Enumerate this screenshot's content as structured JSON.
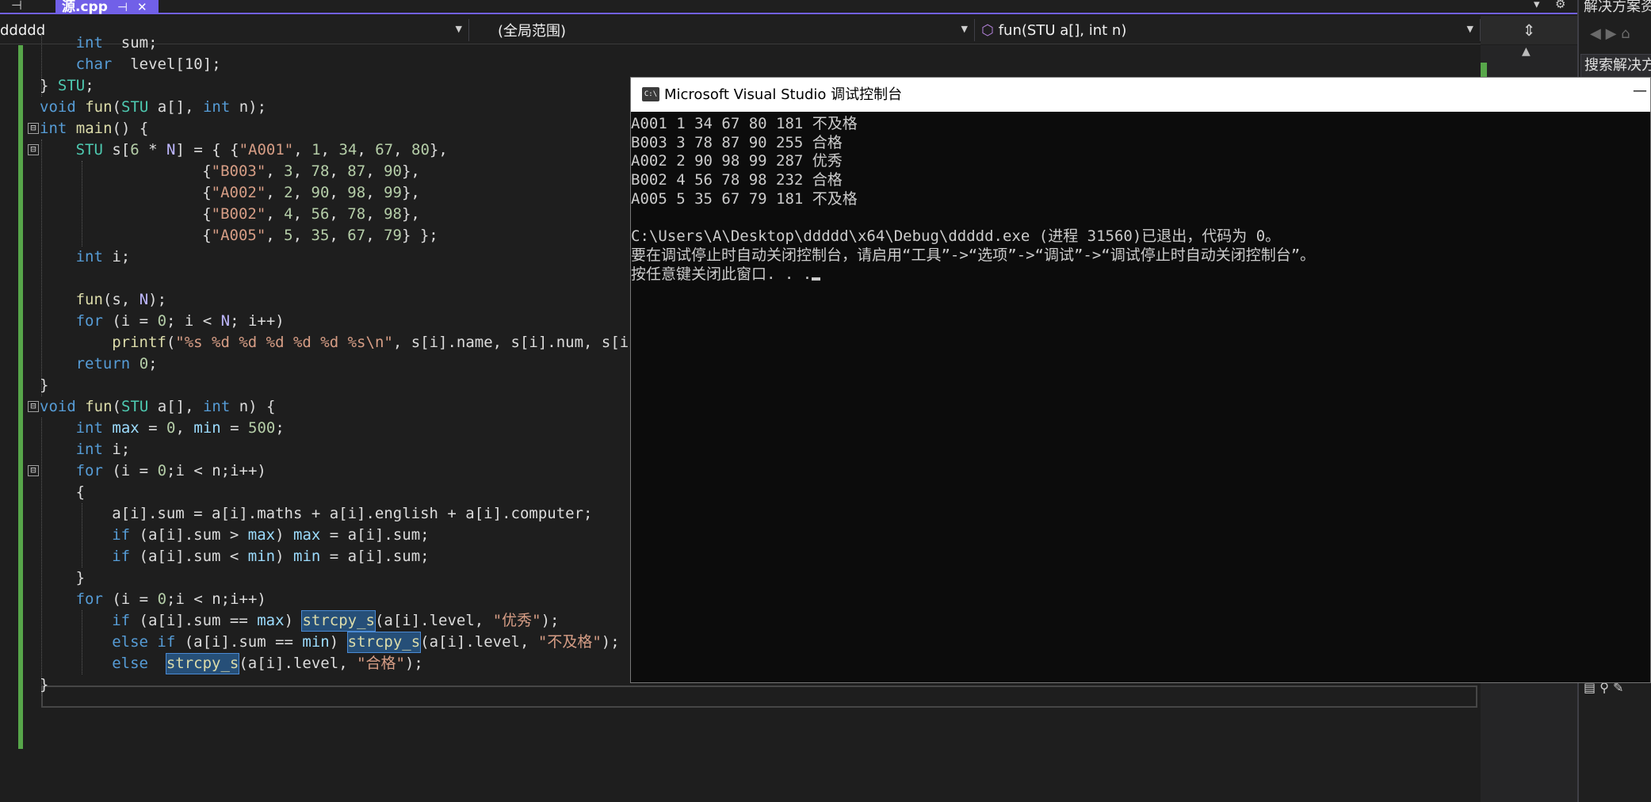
{
  "tabbar": {
    "pin_left": "⊣",
    "active_tab": {
      "title": "源.cpp",
      "pin": "⊣",
      "close": "✕"
    },
    "dropdown_icon": "▾",
    "settings_icon": "⚙"
  },
  "navbar": {
    "project": "ddddd",
    "scope": "(全局范围)",
    "member": "fun(STU a[], int n)",
    "split_icon": "⇕"
  },
  "editor": {
    "lines": [
      {
        "indent": 4,
        "tokens": [
          [
            "kw",
            "int"
          ],
          [
            "",
            "  sum;"
          ]
        ]
      },
      {
        "indent": 4,
        "tokens": [
          [
            "kw",
            "char"
          ],
          [
            "",
            "  level[10];"
          ]
        ]
      },
      {
        "indent": 0,
        "tokens": [
          [
            "",
            "} "
          ],
          [
            "ty",
            "STU"
          ],
          [
            "",
            ";"
          ]
        ]
      },
      {
        "indent": 0,
        "tokens": [
          [
            "kw",
            "void"
          ],
          [
            "",
            " "
          ],
          [
            "fn",
            "fun"
          ],
          [
            "",
            "("
          ],
          [
            "ty",
            "STU"
          ],
          [
            "",
            " a[], "
          ],
          [
            "kw",
            "int"
          ],
          [
            "",
            " n);"
          ]
        ]
      },
      {
        "indent": 0,
        "tokens": [
          [
            "kw",
            "int"
          ],
          [
            "",
            " "
          ],
          [
            "fn",
            "main"
          ],
          [
            "",
            "() {"
          ]
        ]
      },
      {
        "indent": 4,
        "tokens": [
          [
            "ty",
            "STU"
          ],
          [
            "",
            " s["
          ],
          [
            "nm",
            "6"
          ],
          [
            "",
            " * "
          ],
          [
            "mc",
            "N"
          ],
          [
            "",
            "] = { {"
          ],
          [
            "st",
            "\"A001\""
          ],
          [
            "",
            ", "
          ],
          [
            "nm",
            "1"
          ],
          [
            "",
            ", "
          ],
          [
            "nm",
            "34"
          ],
          [
            "",
            ", "
          ],
          [
            "nm",
            "67"
          ],
          [
            "",
            ", "
          ],
          [
            "nm",
            "80"
          ],
          [
            "",
            "},"
          ]
        ]
      },
      {
        "indent": 18,
        "tokens": [
          [
            "",
            "{"
          ],
          [
            "st",
            "\"B003\""
          ],
          [
            "",
            ", "
          ],
          [
            "nm",
            "3"
          ],
          [
            "",
            ", "
          ],
          [
            "nm",
            "78"
          ],
          [
            "",
            ", "
          ],
          [
            "nm",
            "87"
          ],
          [
            "",
            ", "
          ],
          [
            "nm",
            "90"
          ],
          [
            "",
            "},"
          ]
        ]
      },
      {
        "indent": 18,
        "tokens": [
          [
            "",
            "{"
          ],
          [
            "st",
            "\"A002\""
          ],
          [
            "",
            ", "
          ],
          [
            "nm",
            "2"
          ],
          [
            "",
            ", "
          ],
          [
            "nm",
            "90"
          ],
          [
            "",
            ", "
          ],
          [
            "nm",
            "98"
          ],
          [
            "",
            ", "
          ],
          [
            "nm",
            "99"
          ],
          [
            "",
            "},"
          ]
        ]
      },
      {
        "indent": 18,
        "tokens": [
          [
            "",
            "{"
          ],
          [
            "st",
            "\"B002\""
          ],
          [
            "",
            ", "
          ],
          [
            "nm",
            "4"
          ],
          [
            "",
            ", "
          ],
          [
            "nm",
            "56"
          ],
          [
            "",
            ", "
          ],
          [
            "nm",
            "78"
          ],
          [
            "",
            ", "
          ],
          [
            "nm",
            "98"
          ],
          [
            "",
            "},"
          ]
        ]
      },
      {
        "indent": 18,
        "tokens": [
          [
            "",
            "{"
          ],
          [
            "st",
            "\"A005\""
          ],
          [
            "",
            ", "
          ],
          [
            "nm",
            "5"
          ],
          [
            "",
            ", "
          ],
          [
            "nm",
            "35"
          ],
          [
            "",
            ", "
          ],
          [
            "nm",
            "67"
          ],
          [
            "",
            ", "
          ],
          [
            "nm",
            "79"
          ],
          [
            "",
            "} };"
          ]
        ]
      },
      {
        "indent": 4,
        "tokens": [
          [
            "kw",
            "int"
          ],
          [
            "",
            " i;"
          ]
        ]
      },
      {
        "indent": 0,
        "tokens": []
      },
      {
        "indent": 4,
        "tokens": [
          [
            "fn",
            "fun"
          ],
          [
            "",
            "(s, "
          ],
          [
            "mc",
            "N"
          ],
          [
            "",
            ");"
          ]
        ]
      },
      {
        "indent": 4,
        "tokens": [
          [
            "kw",
            "for"
          ],
          [
            "",
            " (i = "
          ],
          [
            "nm",
            "0"
          ],
          [
            "",
            "; i < "
          ],
          [
            "mc",
            "N"
          ],
          [
            "",
            "; i++)"
          ]
        ]
      },
      {
        "indent": 8,
        "tokens": [
          [
            "fn",
            "printf"
          ],
          [
            "",
            "("
          ],
          [
            "st",
            "\"%s %d %d %d %d %d %s\\n\""
          ],
          [
            "",
            ", s[i].name, s[i].num, s[i]"
          ]
        ]
      },
      {
        "indent": 4,
        "tokens": [
          [
            "kw",
            "return"
          ],
          [
            "",
            " "
          ],
          [
            "nm",
            "0"
          ],
          [
            "",
            ";"
          ]
        ]
      },
      {
        "indent": 0,
        "tokens": [
          [
            "",
            "}"
          ]
        ]
      },
      {
        "indent": 0,
        "tokens": [
          [
            "kw",
            "void"
          ],
          [
            "",
            " "
          ],
          [
            "fn",
            "fun"
          ],
          [
            "",
            "("
          ],
          [
            "ty",
            "STU"
          ],
          [
            "",
            " a[], "
          ],
          [
            "kw",
            "int"
          ],
          [
            "",
            " n) {"
          ]
        ]
      },
      {
        "indent": 4,
        "tokens": [
          [
            "kw",
            "int"
          ],
          [
            "",
            " "
          ],
          [
            "vr",
            "max"
          ],
          [
            "",
            " = "
          ],
          [
            "nm",
            "0"
          ],
          [
            "",
            ", "
          ],
          [
            "vr",
            "min"
          ],
          [
            "",
            " = "
          ],
          [
            "nm",
            "500"
          ],
          [
            "",
            ";"
          ]
        ]
      },
      {
        "indent": 4,
        "tokens": [
          [
            "kw",
            "int"
          ],
          [
            "",
            " i;"
          ]
        ]
      },
      {
        "indent": 4,
        "tokens": [
          [
            "kw",
            "for"
          ],
          [
            "",
            " (i = "
          ],
          [
            "nm",
            "0"
          ],
          [
            "",
            ";i < n;i++)"
          ]
        ]
      },
      {
        "indent": 4,
        "tokens": [
          [
            "",
            "{"
          ]
        ]
      },
      {
        "indent": 8,
        "tokens": [
          [
            "",
            "a[i].sum = a[i].maths + a[i].english + a[i].computer;"
          ]
        ]
      },
      {
        "indent": 8,
        "tokens": [
          [
            "kw",
            "if"
          ],
          [
            "",
            " (a[i].sum > "
          ],
          [
            "vr",
            "max"
          ],
          [
            "",
            ") "
          ],
          [
            "vr",
            "max"
          ],
          [
            "",
            " = a[i].sum;"
          ]
        ]
      },
      {
        "indent": 8,
        "tokens": [
          [
            "kw",
            "if"
          ],
          [
            "",
            " (a[i].sum < "
          ],
          [
            "vr",
            "min"
          ],
          [
            "",
            ") "
          ],
          [
            "vr",
            "min"
          ],
          [
            "",
            " = a[i].sum;"
          ]
        ]
      },
      {
        "indent": 4,
        "tokens": [
          [
            "",
            "}"
          ]
        ]
      },
      {
        "indent": 4,
        "tokens": [
          [
            "kw",
            "for"
          ],
          [
            "",
            " (i = "
          ],
          [
            "nm",
            "0"
          ],
          [
            "",
            ";i < n;i++)"
          ]
        ]
      },
      {
        "indent": 8,
        "tokens": [
          [
            "kw",
            "if"
          ],
          [
            "",
            " (a[i].sum == "
          ],
          [
            "vr",
            "max"
          ],
          [
            "",
            ") "
          ],
          [
            "fn",
            "strcpy_s"
          ],
          [
            "",
            "(a[i].level, "
          ],
          [
            "st",
            "\"优秀\""
          ],
          [
            "",
            ");"
          ]
        ]
      },
      {
        "indent": 8,
        "tokens": [
          [
            "kw",
            "else if"
          ],
          [
            "",
            " (a[i].sum == "
          ],
          [
            "vr",
            "min"
          ],
          [
            "",
            ") "
          ],
          [
            "fn",
            "strcpy_s"
          ],
          [
            "",
            "(a[i].level, "
          ],
          [
            "st",
            "\"不及格\""
          ],
          [
            "",
            ");"
          ]
        ]
      },
      {
        "indent": 8,
        "tokens": [
          [
            "kw",
            "else"
          ],
          [
            "",
            "  "
          ],
          [
            "fn",
            "strcpy_s"
          ],
          [
            "",
            "(a[i].level, "
          ],
          [
            "st",
            "\"合格\""
          ],
          [
            "",
            ");"
          ]
        ]
      },
      {
        "indent": 0,
        "tokens": [
          [
            "",
            "}"
          ]
        ]
      }
    ],
    "fold_markers": [
      "⊟",
      "⊟",
      "⊟",
      "⊟"
    ]
  },
  "console": {
    "title": "Microsoft Visual Studio 调试控制台",
    "icon_label": "C:\\",
    "minimize": "—",
    "lines": [
      "A001 1 34 67 80 181 不及格",
      "B003 3 78 87 90 255 合格",
      "A002 2 90 98 99 287 优秀",
      "B002 4 56 78 98 232 合格",
      "A005 5 35 67 79 181 不及格",
      "",
      "C:\\Users\\A\\Desktop\\ddddd\\x64\\Debug\\ddddd.exe (进程 31560)已退出，代码为 0。",
      "要在调试停止时自动关闭控制台，请启用“工具”->“选项”->“调试”->“调试停止时自动关闭控制台”。",
      "按任意键关闭此窗口. . ."
    ]
  },
  "solution_panel": {
    "title": "解决方案资",
    "search_placeholder": "搜索解决方",
    "nav_icons": "◀ ▶ ⌂",
    "bottom_icons": "▤ ⚲ ✎"
  },
  "scroll": {
    "up_arrow": "▲"
  }
}
